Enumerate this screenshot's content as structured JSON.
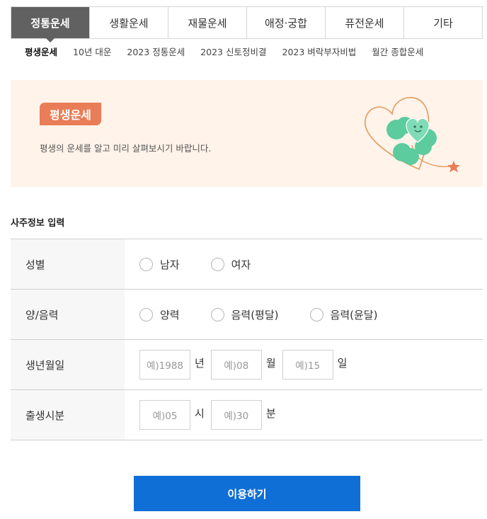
{
  "tabs": [
    {
      "label": "정통운세",
      "active": true
    },
    {
      "label": "생활운세",
      "active": false
    },
    {
      "label": "재물운세",
      "active": false
    },
    {
      "label": "애정·궁합",
      "active": false
    },
    {
      "label": "퓨전운세",
      "active": false
    },
    {
      "label": "기타",
      "active": false
    }
  ],
  "subtabs": [
    {
      "label": "평생운세",
      "active": true
    },
    {
      "label": "10년 대운",
      "active": false
    },
    {
      "label": "2023 정통운세",
      "active": false
    },
    {
      "label": "2023 신토정비결",
      "active": false
    },
    {
      "label": "2023 벼락부자비법",
      "active": false
    },
    {
      "label": "월간 종합운세",
      "active": false
    }
  ],
  "banner": {
    "badge": "평생운세",
    "description": "평생의 운세를 알고 미리 살펴보시기 바랍니다.",
    "colors": {
      "background": "#fff3ea",
      "badge": "#e97d57",
      "clover": "#5ccb9e",
      "outline": "#e39b5c",
      "star": "#e97d57"
    },
    "icon": "clover-heart-icon"
  },
  "form": {
    "section_title": "사주정보 입력",
    "gender": {
      "label": "성별",
      "options": [
        "남자",
        "여자"
      ]
    },
    "calendar": {
      "label": "양/음력",
      "options": [
        "양력",
        "음력(평달)",
        "음력(윤달)"
      ]
    },
    "birthdate": {
      "label": "생년월일",
      "year_placeholder": "예)1988",
      "year_unit": "년",
      "month_placeholder": "예)08",
      "month_unit": "월",
      "day_placeholder": "예)15",
      "day_unit": "일"
    },
    "birthtime": {
      "label": "출생시분",
      "hour_placeholder": "예)05",
      "hour_unit": "시",
      "minute_placeholder": "예)30",
      "minute_unit": "분"
    }
  },
  "submit_label": "이용하기",
  "colors": {
    "accent": "#0f6fd6",
    "active_tab": "#616161"
  }
}
